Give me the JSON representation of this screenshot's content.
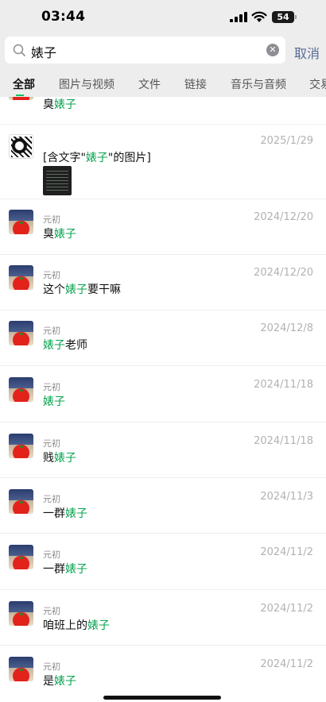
{
  "status_bar": {
    "time": "03:44",
    "battery": "54"
  },
  "search": {
    "query": "婊子",
    "cancel_label": "取消"
  },
  "tabs": [
    "全部",
    "图片与视频",
    "文件",
    "链接",
    "音乐与音频",
    "交易"
  ],
  "results": [
    {
      "type": "text",
      "partial": true,
      "prefix": "臭",
      "keyword": "婊子",
      "suffix": ""
    },
    {
      "type": "image",
      "date": "2025/1/29",
      "prefix": "[含文字\"",
      "keyword": "婊子",
      "suffix": "\"的图片]"
    },
    {
      "type": "text",
      "sender": "元初",
      "date": "2024/12/20",
      "prefix": "臭",
      "keyword": "婊子",
      "suffix": ""
    },
    {
      "type": "text",
      "sender": "元初",
      "date": "2024/12/20",
      "prefix": "这个",
      "keyword": "婊子",
      "suffix": "要干嘛"
    },
    {
      "type": "text",
      "sender": "元初",
      "date": "2024/12/8",
      "prefix": "",
      "keyword": "婊子",
      "suffix": "老师"
    },
    {
      "type": "text",
      "sender": "元初",
      "date": "2024/11/18",
      "prefix": "",
      "keyword": "婊子",
      "suffix": ""
    },
    {
      "type": "text",
      "sender": "元初",
      "date": "2024/11/18",
      "prefix": "贱",
      "keyword": "婊子",
      "suffix": ""
    },
    {
      "type": "text",
      "sender": "元初",
      "date": "2024/11/3",
      "prefix": "一群",
      "keyword": "婊子",
      "suffix": ""
    },
    {
      "type": "text",
      "sender": "元初",
      "date": "2024/11/2",
      "prefix": "一群",
      "keyword": "婊子",
      "suffix": ""
    },
    {
      "type": "text",
      "sender": "元初",
      "date": "2024/11/2",
      "prefix": "咱班上的",
      "keyword": "婊子",
      "suffix": ""
    },
    {
      "type": "text",
      "sender": "元初",
      "date": "2024/11/2",
      "prefix": "是",
      "keyword": "婊子",
      "suffix": ""
    }
  ],
  "colors": {
    "highlight": "#07a34f",
    "cancel": "#576b95",
    "tab_underline": "#07c160",
    "header_bg": "#ededed"
  },
  "icons": {
    "search": "magnifier-icon",
    "clear": "clear-circle-icon"
  }
}
